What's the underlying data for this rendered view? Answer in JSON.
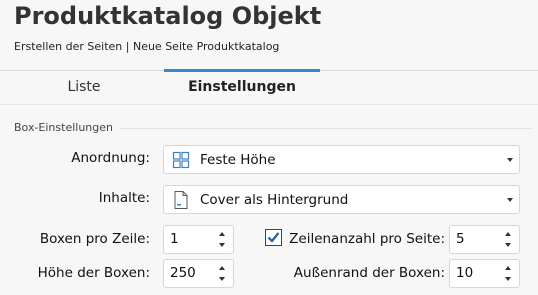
{
  "header": {
    "title": "Produktkatalog Objekt",
    "breadcrumb": "Erstellen der Seiten | Neue Seite Produktkatalog"
  },
  "tabs": [
    {
      "label": "Liste",
      "active": false
    },
    {
      "label": "Einstellungen",
      "active": true
    }
  ],
  "accent_color": "#3b86c4",
  "section": {
    "label": "Box-Einstellungen"
  },
  "fields": {
    "anordnung": {
      "label": "Anordnung:",
      "value": "Feste Höhe",
      "icon": "grid-layout-icon"
    },
    "inhalte": {
      "label": "Inhalte:",
      "value": "Cover als Hintergrund",
      "icon": "page-icon"
    },
    "boxen_pro_zeile": {
      "label": "Boxen pro Zeile:",
      "value": "1"
    },
    "zeilenanzahl": {
      "label": "Zeilenanzahl pro Seite:",
      "checked": true,
      "value": "5"
    },
    "hoehe_boxen": {
      "label": "Höhe der Boxen:",
      "value": "250"
    },
    "aussenrand": {
      "label": "Außenrand der Boxen:",
      "value": "10"
    }
  }
}
